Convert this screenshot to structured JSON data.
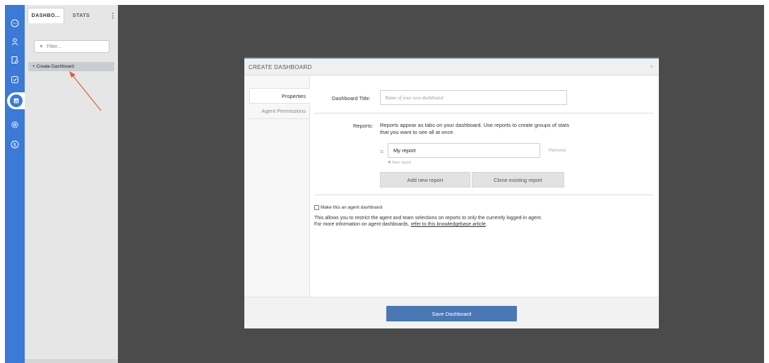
{
  "sidebar": {
    "tabs": {
      "dashboards": "DASHBO...",
      "stats": "STATS",
      "more": "⋮"
    },
    "filter_placeholder": "Filter...",
    "create_item": "+ Create Dashboard"
  },
  "rail": {
    "icons": [
      "chat-icon",
      "user-icon",
      "report-icon",
      "check-icon",
      "dashboard-icon",
      "settings-icon",
      "billing-icon"
    ],
    "accent_color": "#3b7ad6"
  },
  "modal": {
    "title": "CREATE DASHBOARD",
    "close": "×",
    "tabs": {
      "properties": "Properties",
      "agent_permissions": "Agent Permissions"
    },
    "dashboard_title_label": "Dashboard Title:",
    "dashboard_title_placeholder": "Name of your new dashboard",
    "reports_label": "Reports:",
    "reports_desc": "Reports appear as tabs on your dashboard. Use reports to create groups of stats that you want to see all at once.",
    "report_value": "My report",
    "remove": "Remove",
    "new_report": "✱ New report",
    "add_new_report": "Add new report",
    "clone_existing_report": "Clone existing report",
    "agent_dashboard_checkbox": "Make this an agent dashboard",
    "info_line1": "This allows you to restrict the agent and team selections on reports to only the currently logged-in agent.",
    "info_line2_prefix": "For more information on agent dashboards, ",
    "info_link": "refer to this knowledgebase article",
    "info_line2_suffix": ".",
    "save": "Save Dashboard",
    "primary_color": "#4a78b5"
  }
}
